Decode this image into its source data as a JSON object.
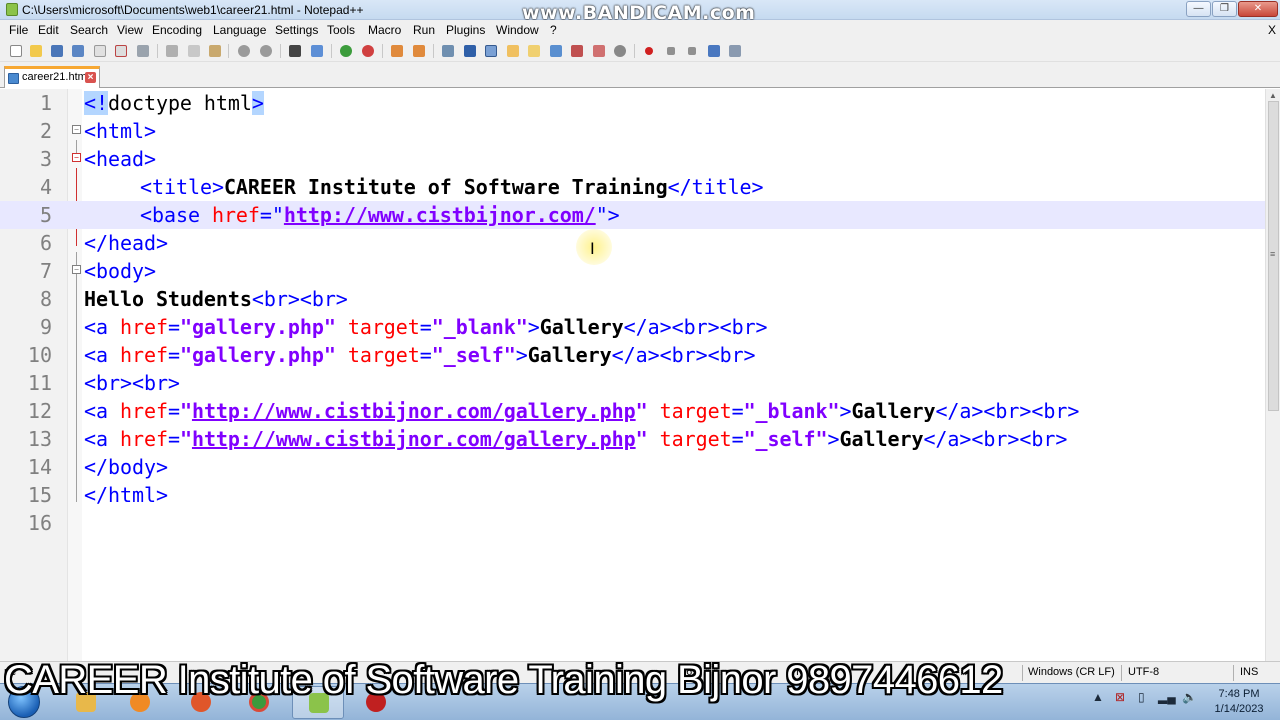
{
  "window": {
    "title": "C:\\Users\\microsoft\\Documents\\web1\\career21.html - Notepad++",
    "watermark": "www.BANDICAM.com",
    "minimize_glyph": "—",
    "maximize_glyph": "❐",
    "close_glyph": "✕"
  },
  "menu": {
    "items": [
      "File",
      "Edit",
      "Search",
      "View",
      "Encoding",
      "Language",
      "Settings",
      "Tools",
      "Macro",
      "Run",
      "Plugins",
      "Window",
      "?"
    ],
    "close_label": "X"
  },
  "toolbar": {
    "icons": [
      "new-file-icon",
      "open-file-icon",
      "save-icon",
      "save-all-icon",
      "close-icon",
      "close-all-icon",
      "print-icon",
      "cut-icon",
      "copy-icon",
      "paste-icon",
      "undo-icon",
      "redo-icon",
      "find-icon",
      "replace-icon",
      "zoom-in-icon",
      "zoom-out-icon",
      "sync-v-icon",
      "sync-h-icon",
      "word-wrap-icon",
      "all-chars-icon",
      "indent-guide-icon",
      "lang-icon",
      "doc-map-icon",
      "function-list-icon",
      "folder-workspace-icon",
      "monitor-icon",
      "record-macro-icon",
      "stop-macro-icon",
      "play-macro-icon",
      "run-multiple-macro-icon",
      "save-macro-icon"
    ]
  },
  "tabs": [
    {
      "label": "career21.html",
      "active": true
    }
  ],
  "editor": {
    "current_line": 5,
    "lines": [
      {
        "n": "1"
      },
      {
        "n": "2"
      },
      {
        "n": "3"
      },
      {
        "n": "4"
      },
      {
        "n": "5"
      },
      {
        "n": "6"
      },
      {
        "n": "7"
      },
      {
        "n": "8"
      },
      {
        "n": "9"
      },
      {
        "n": "10"
      },
      {
        "n": "11"
      },
      {
        "n": "12"
      },
      {
        "n": "13"
      },
      {
        "n": "14"
      },
      {
        "n": "15"
      },
      {
        "n": "16"
      }
    ],
    "code": {
      "l1": [
        "<!",
        "doctype html",
        ">"
      ],
      "l2": [
        "<html>"
      ],
      "l3": [
        "<head>"
      ],
      "l4": [
        "<title>",
        "CAREER Institute of Software Training",
        "</title>"
      ],
      "l5": [
        "<base ",
        "href",
        "=\"",
        "http://www.cistbijnor.com/",
        "\">"
      ],
      "l6": [
        "</head>"
      ],
      "l7": [
        "<body>"
      ],
      "l8": [
        "Hello Students",
        "<br><br>"
      ],
      "l9": [
        "<a ",
        "href",
        "=",
        "\"gallery.php\"",
        " target",
        "=",
        "\"_blank\"",
        ">",
        "Gallery",
        "</a><br><br>"
      ],
      "l10": [
        "<a ",
        "href",
        "=",
        "\"gallery.php\"",
        " target",
        "=",
        "\"_self\"",
        ">",
        "Gallery",
        "</a><br><br>"
      ],
      "l11": [
        "<br><br>"
      ],
      "l12": [
        "<a ",
        "href",
        "=",
        "\"",
        "http://www.cistbijnor.com/gallery.php",
        "\"",
        " target",
        "=",
        "\"_blank\"",
        ">",
        "Gallery",
        "</a><br><br>"
      ],
      "l13": [
        "<a ",
        "href",
        "=",
        "\"",
        "http://www.cistbijnor.com/gallery.php",
        "\"",
        " target",
        "=",
        "\"_self\"",
        ">",
        "Gallery",
        "</a><br><br>"
      ],
      "l14": [
        "</body>"
      ],
      "l15": [
        "</html>"
      ]
    }
  },
  "statusbar": {
    "eol": "Windows (CR LF)",
    "encoding": "UTF-8",
    "mode": "INS",
    "partial_left": "pe",
    "partial_mid1": "16",
    "partial_mid2": "ln : 5"
  },
  "taskbar": {
    "time": "7:48 PM",
    "date": "1/14/2023"
  },
  "caption": "CAREER Institute of Software Training Bijnor 9897446612",
  "colors": {
    "tag": "#0000ff",
    "attr": "#ff0000",
    "string": "#8000ff",
    "current_line": "#e8e8ff",
    "tab_accent": "#f7a833"
  }
}
